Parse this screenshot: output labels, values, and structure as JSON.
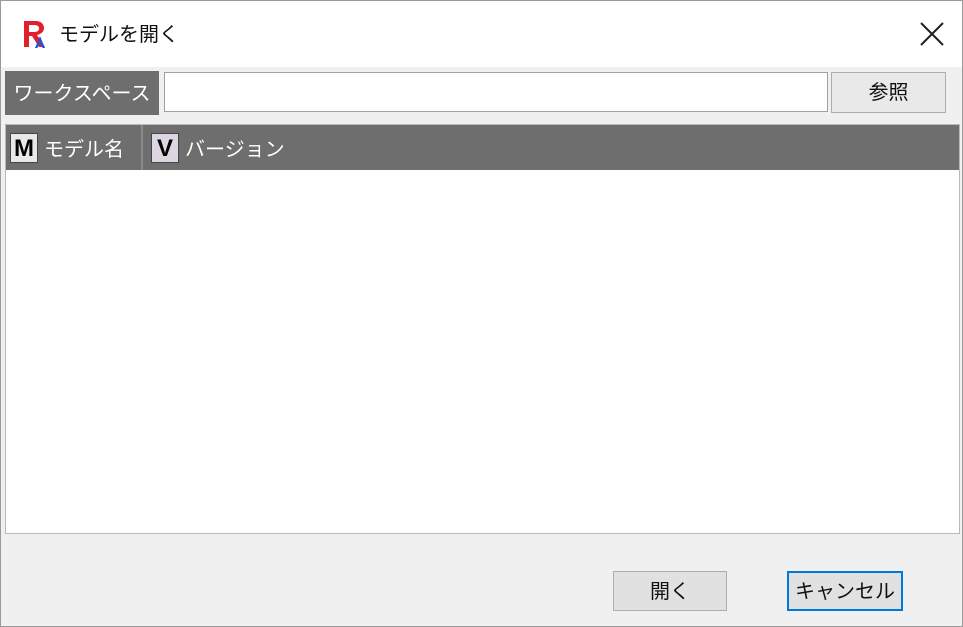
{
  "window": {
    "title": "モデルを開く"
  },
  "workspace": {
    "label": "ワークスペース",
    "value": "",
    "browse_label": "参照"
  },
  "list": {
    "columns": [
      {
        "badge": "M",
        "label": "モデル名"
      },
      {
        "badge": "V",
        "label": "バージョン"
      }
    ],
    "rows": []
  },
  "footer": {
    "open_label": "開く",
    "cancel_label": "キャンセル"
  },
  "colors": {
    "header_bg": "#6e6e6e",
    "logo_red": "#e0202a",
    "logo_blue": "#2a4fd8",
    "focus_blue": "#0078d7"
  }
}
